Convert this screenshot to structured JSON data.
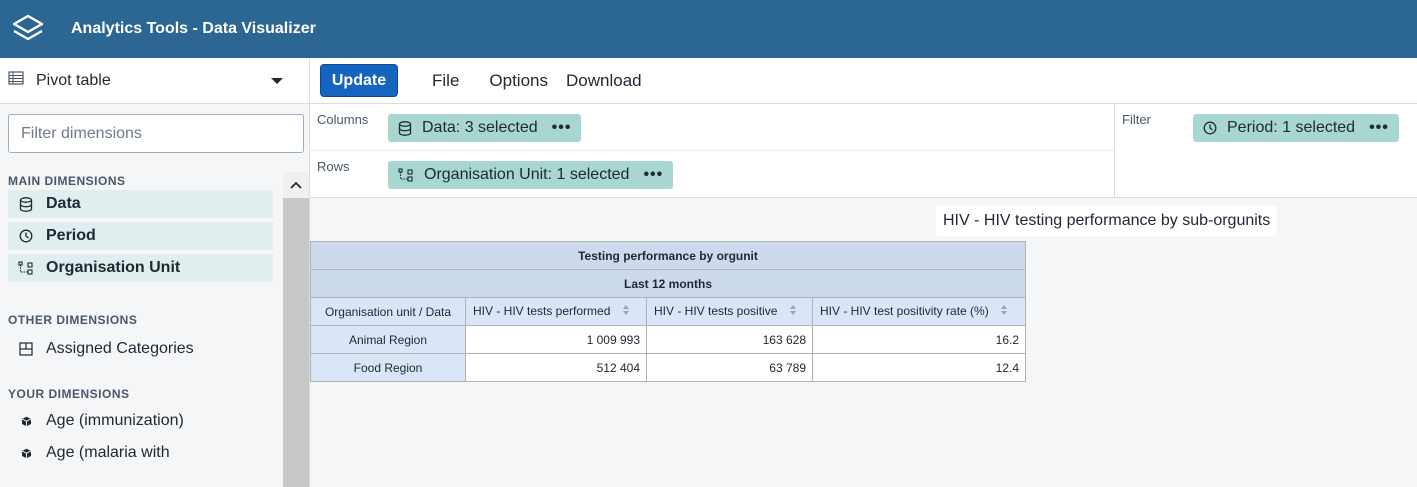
{
  "app": {
    "title": "Analytics Tools - Data Visualizer"
  },
  "vis_type": {
    "label": "Pivot table"
  },
  "filter": {
    "placeholder": "Filter dimensions"
  },
  "main_dimensions": {
    "title": "MAIN DIMENSIONS",
    "items": [
      {
        "label": "Data",
        "icon": "database-icon"
      },
      {
        "label": "Period",
        "icon": "clock-icon"
      },
      {
        "label": "Organisation Unit",
        "icon": "orgunit-tree-icon"
      }
    ]
  },
  "other_dimensions": {
    "title": "OTHER DIMENSIONS",
    "items": [
      {
        "label": "Assigned Categories",
        "icon": "categories-icon"
      }
    ]
  },
  "your_dimensions": {
    "title": "YOUR DIMENSIONS",
    "items": [
      {
        "label": "Age (immunization)",
        "icon": "cube-icon"
      },
      {
        "label": "Age (malaria with",
        "icon": "cube-icon"
      }
    ]
  },
  "toolbar": {
    "update": "Update",
    "file": "File",
    "options": "Options",
    "download": "Download"
  },
  "layout": {
    "columns_label": "Columns",
    "rows_label": "Rows",
    "filter_label": "Filter",
    "columns_chip": "Data: 3 selected",
    "rows_chip": "Organisation Unit: 1 selected",
    "filter_chip": "Period: 1 selected",
    "chip_menu": "•••"
  },
  "visualization": {
    "title": "HIV - HIV testing performance by sub-orgunits",
    "table_title": "Testing performance by orgunit",
    "table_subtitle": "Last 12 months",
    "corner_header": "Organisation unit / Data",
    "columns": [
      "HIV - HIV tests performed",
      "HIV - HIV tests positive",
      "HIV - HIV test positivity rate (%)"
    ],
    "rows": [
      {
        "name": "Animal Region",
        "values": [
          "1 009 993",
          "163 628",
          "16.2"
        ]
      },
      {
        "name": "Food Region",
        "values": [
          "512 404",
          "63 789",
          "12.4"
        ]
      }
    ]
  },
  "colors": {
    "header": "#2c6693",
    "chip": "#a7d7d0",
    "update_button": "#1565c0",
    "table_header": "#dae6f8"
  }
}
